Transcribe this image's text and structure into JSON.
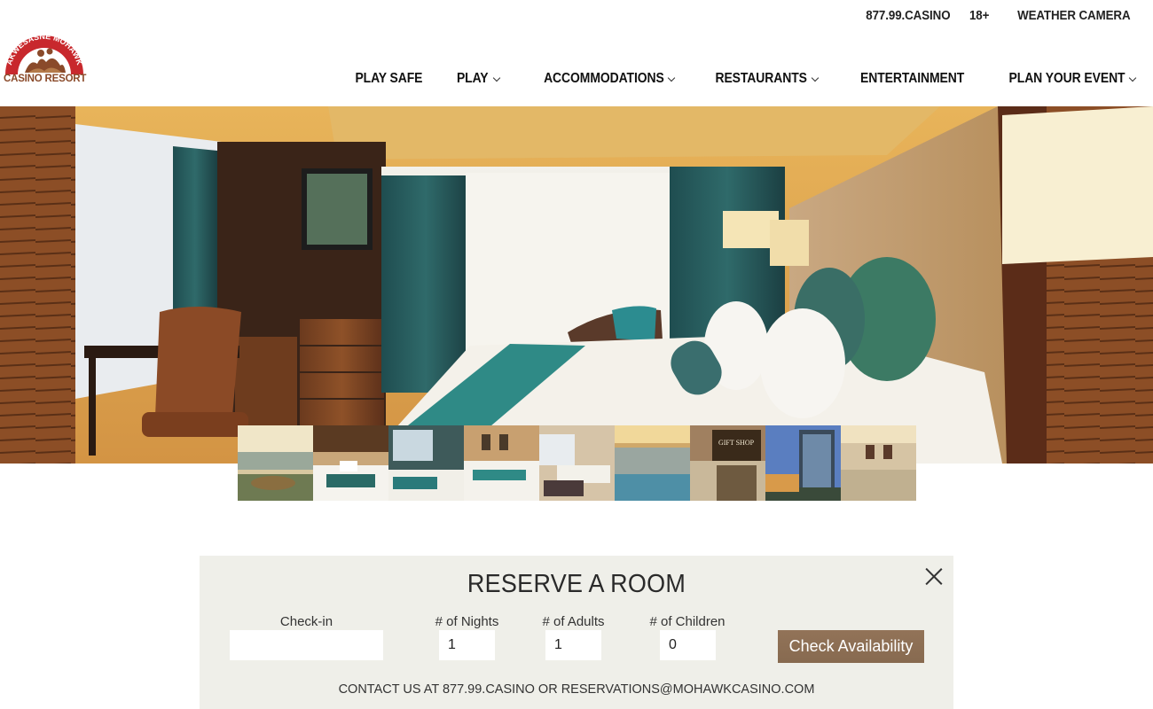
{
  "logo": {
    "arc_text": "AKWESASNE MOHAWK",
    "bottom_text": "CASINO RESORT"
  },
  "topbar": {
    "links": [
      "877.99.CASINO",
      "18+",
      "WEATHER CAMERA"
    ]
  },
  "nav": {
    "items": [
      {
        "label": "PLAY SAFE",
        "icon": null
      },
      {
        "label": "PLAY",
        "icon": "chevron-down-icon"
      },
      {
        "label": "ACCOMMODATIONS",
        "icon": "chevron-down-icon"
      },
      {
        "label": "RESTAURANTS",
        "icon": "chevron-down-icon"
      },
      {
        "label": "ENTERTAINMENT",
        "icon": null
      },
      {
        "label": "PLAN YOUR EVENT",
        "icon": "chevron-down-icon"
      }
    ]
  },
  "thumbnails": {
    "count": 9,
    "gift_shop_sign": "GIFT SHOP"
  },
  "reserve": {
    "title": "RESERVE A ROOM",
    "checkin_label": "Check-in",
    "checkin_value": "",
    "nights_label": "# of Nights",
    "nights_value": "1",
    "adults_label": "# of Adults",
    "adults_value": "1",
    "children_label": "# of Children",
    "children_value": "0",
    "button_label": "Check Availability",
    "contact": "CONTACT US AT 877.99.CASINO OR RESERVATIONS@MOHAWKCASINO.COM"
  },
  "colors": {
    "logo_red": "#c8282d",
    "logo_brown": "#8a4a2a",
    "button_brown": "#8d6f55",
    "panel_bg": "#efefe9"
  }
}
